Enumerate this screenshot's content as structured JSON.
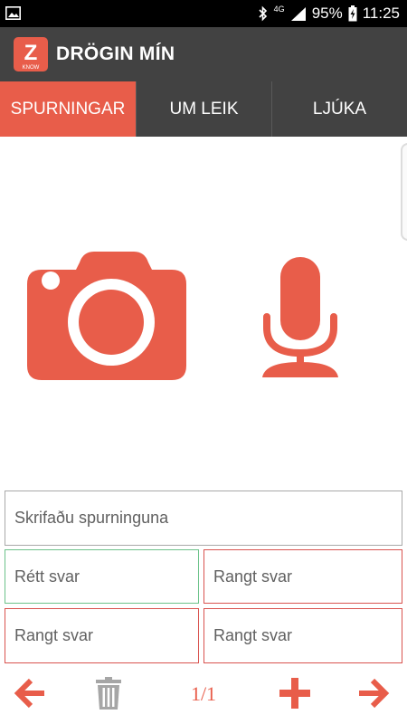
{
  "status_bar": {
    "signal_label": "4G",
    "battery_text": "95%",
    "time": "11:25"
  },
  "app_bar": {
    "title": "DRÖGIN MÍN",
    "logo": {
      "mark": "Z",
      "subtext": "KNOW"
    }
  },
  "tabs": [
    {
      "label": "SPURNINGAR",
      "active": true
    },
    {
      "label": "UM LEIK",
      "active": false
    },
    {
      "label": "LJÚKA",
      "active": false
    }
  ],
  "question": {
    "placeholder": "Skrifaðu spurninguna"
  },
  "answers": {
    "correct_placeholder": "Rétt svar",
    "wrong_placeholder_1": "Rangt svar",
    "wrong_placeholder_2": "Rangt svar",
    "wrong_placeholder_3": "Rangt svar"
  },
  "pagination": {
    "text": "1/1"
  },
  "icons": {
    "camera": "camera-icon",
    "microphone": "microphone-icon",
    "previous": "arrow-left-icon",
    "delete": "trash-icon",
    "add": "plus-icon",
    "next": "arrow-right-icon"
  },
  "colors": {
    "accent": "#e85d4a",
    "app_bar": "#424242",
    "status_bar": "#000000",
    "correct_border": "#6cc28a",
    "wrong_border": "#d9534f",
    "question_border": "#a8a8a8"
  }
}
